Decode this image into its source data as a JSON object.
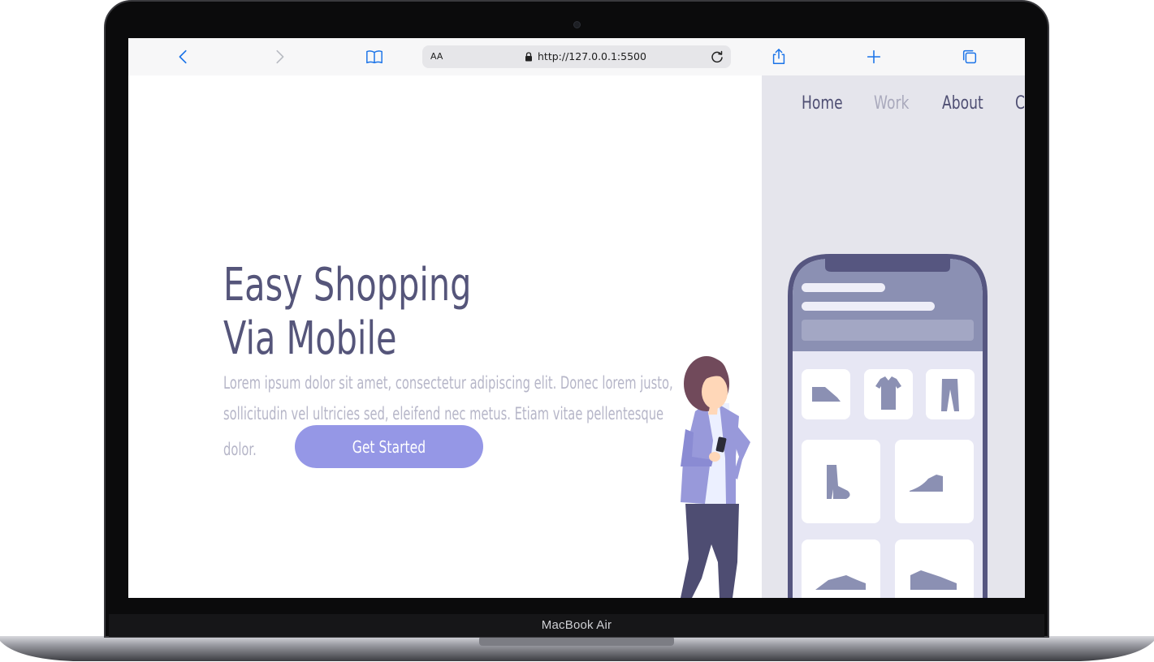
{
  "device": {
    "model_label": "MacBook Air"
  },
  "browser": {
    "address_bar": {
      "text_size_label": "AA",
      "url": "http://127.0.0.1:5500"
    }
  },
  "nav": {
    "items": [
      "Home",
      "Work",
      "About",
      "C"
    ]
  },
  "hero": {
    "title_line1": "Easy Shopping",
    "title_line2": "Via Mobile",
    "text_line1": "Lorem ipsum dolor sit amet, consectetur adipiscing elit. Donec lorem justo,",
    "text_line2": "sollicitudin vel ultricies sed, eleifend nec metus. Etiam vitae pellentesque",
    "text_line3": "dolor.",
    "cta_label": "Get Started"
  },
  "colors": {
    "accent": "#9597e6",
    "heading": "#55557a",
    "body_text": "#b6b6c8",
    "nav_active": "#4f4f73",
    "nav_muted": "#a9a9bc",
    "panel_bg": "#e5e5ec",
    "safari_blue": "#1a73e8"
  },
  "icons": [
    "back-icon",
    "forward-icon",
    "bookmarks-icon",
    "lock-icon",
    "reload-icon",
    "share-icon",
    "new-tab-icon",
    "tabs-icon"
  ]
}
